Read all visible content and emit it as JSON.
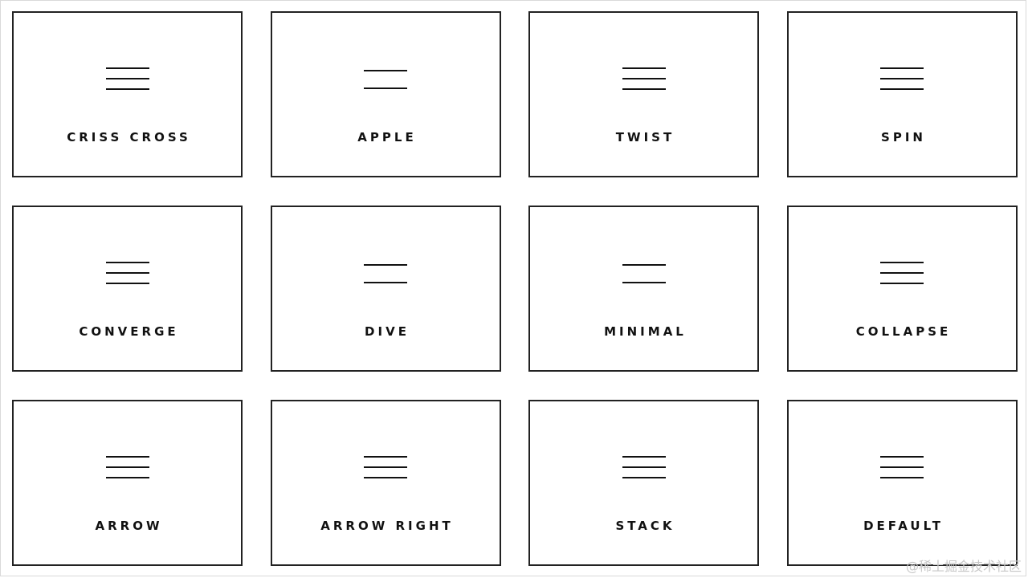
{
  "cards": [
    {
      "label": "CRISS CROSS",
      "icon": "hamburger-three-lines-icon"
    },
    {
      "label": "APPLE",
      "icon": "hamburger-two-lines-icon"
    },
    {
      "label": "TWIST",
      "icon": "hamburger-three-lines-icon"
    },
    {
      "label": "SPIN",
      "icon": "hamburger-three-lines-icon"
    },
    {
      "label": "CONVERGE",
      "icon": "hamburger-three-lines-icon"
    },
    {
      "label": "DIVE",
      "icon": "hamburger-two-lines-icon"
    },
    {
      "label": "MINIMAL",
      "icon": "hamburger-two-lines-icon"
    },
    {
      "label": "COLLAPSE",
      "icon": "hamburger-three-lines-icon"
    },
    {
      "label": "ARROW",
      "icon": "hamburger-three-lines-icon"
    },
    {
      "label": "ARROW RIGHT",
      "icon": "hamburger-three-lines-icon"
    },
    {
      "label": "STACK",
      "icon": "hamburger-three-lines-icon"
    },
    {
      "label": "DEFAULT",
      "icon": "hamburger-three-lines-icon"
    }
  ],
  "watermark": "@稀土掘金技术社区",
  "colors": {
    "background": "#ffffff",
    "border": "#222222",
    "text": "#111111",
    "watermark": "#c7c7c7"
  }
}
